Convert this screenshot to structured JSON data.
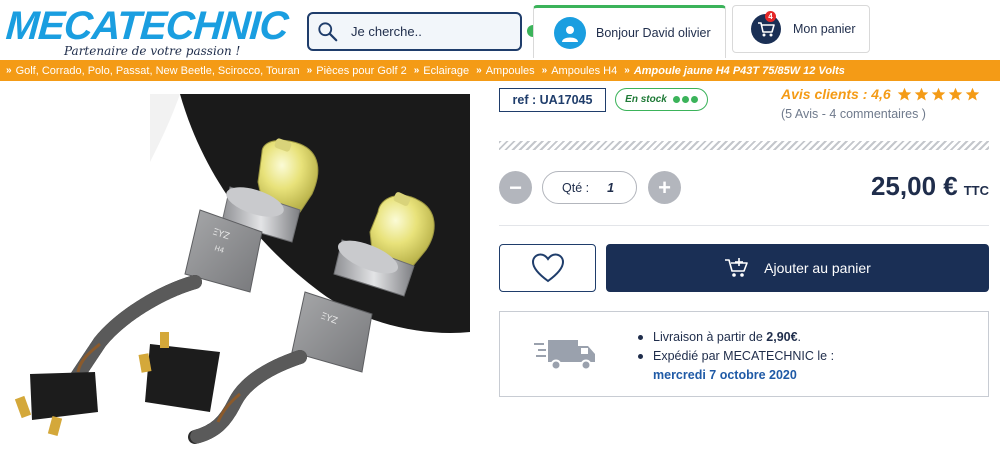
{
  "header": {
    "logo_text": "MECATECHNIC",
    "logo_tagline": "Partenaire de votre passion !",
    "search_placeholder": "Je cherche..",
    "account_label": "Bonjour David olivier",
    "cart_label": "Mon panier",
    "cart_count": "4"
  },
  "breadcrumb": {
    "items": [
      "Golf, Corrado, Polo, Passat, New Beetle, Scirocco, Touran",
      "Pièces pour Golf 2",
      "Eclairage",
      "Ampoules",
      "Ampoules H4"
    ],
    "current": "Ampoule jaune H4 P43T 75/85W 12 Volts"
  },
  "product": {
    "ref": "ref : UA17045",
    "stock": "En stock",
    "reviews_title": "Avis clients : 4,6",
    "rating": 4.6,
    "reviews_count": "(5 Avis - 4 commentaires )",
    "qty_label": "Qté :",
    "qty_value": "1",
    "price": "25,00 €",
    "price_suffix": "TTC",
    "add_to_cart": "Ajouter au panier",
    "socket_label": "H4"
  },
  "delivery": {
    "line1_prefix": "Livraison à partir de",
    "line1_price": "2,90€",
    "line1_suffix": ".",
    "line2": "Expédié par MECATECHNIC le :",
    "line2_date": "mercredi 7 octobre 2020"
  },
  "colors": {
    "brand_blue": "#1a9ee0",
    "navy": "#1a2f55",
    "orange": "#f49b16",
    "green": "#3bb35a"
  }
}
